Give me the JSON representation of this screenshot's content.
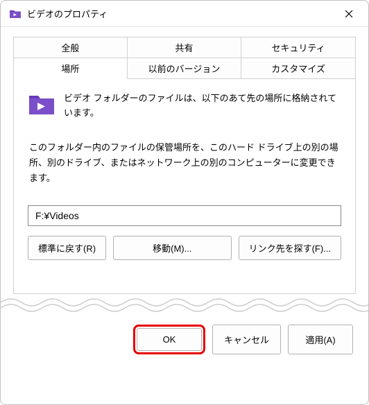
{
  "titlebar": {
    "title": "ビデオのプロパティ",
    "icon": "video-folder-icon",
    "close": "×"
  },
  "tabs": {
    "row1": [
      {
        "label": "全般"
      },
      {
        "label": "共有"
      },
      {
        "label": "セキュリティ"
      }
    ],
    "row2": [
      {
        "label": "場所",
        "active": true
      },
      {
        "label": "以前のバージョン"
      },
      {
        "label": "カスタマイズ"
      }
    ]
  },
  "content": {
    "description": "ビデオ フォルダーのファイルは、以下のあて先の場所に格納されています。",
    "instruction": "このフォルダー内のファイルの保管場所を、このハード ドライブ上の別の場所、別のドライブ、またはネットワーク上の別のコンピューターに変更できます。",
    "path": "F:¥Videos",
    "buttons": {
      "restore": "標準に戻す(R)",
      "move": "移動(M)...",
      "find": "リンク先を探す(F)..."
    }
  },
  "footer": {
    "ok": "OK",
    "cancel": "キャンセル",
    "apply": "適用(A)"
  },
  "colors": {
    "folder_primary": "#7b4fc9",
    "folder_accent": "#6839b8",
    "highlight": "#e60000"
  }
}
